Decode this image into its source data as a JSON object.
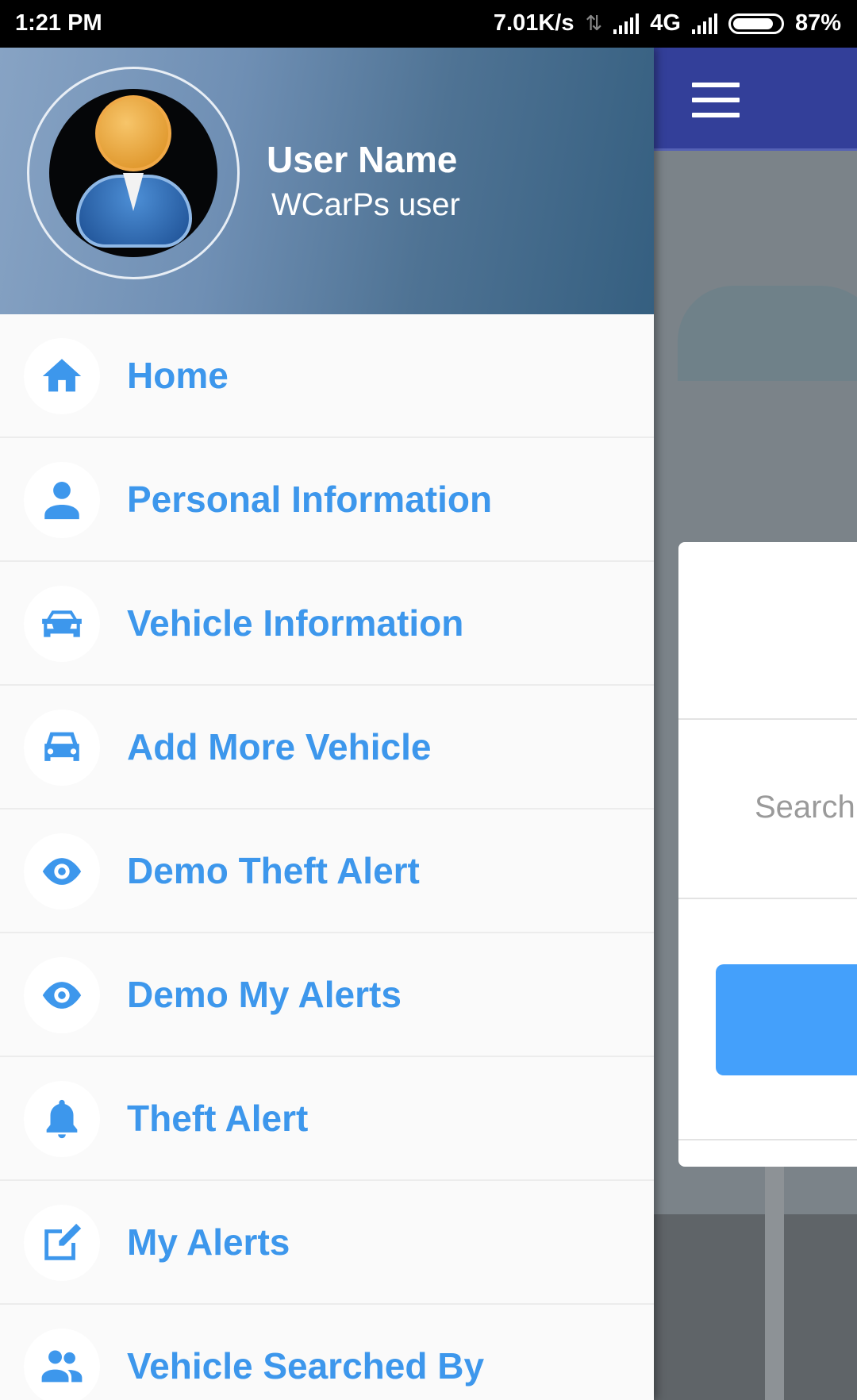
{
  "status_bar": {
    "time": "1:21 PM",
    "net_speed": "7.01K/s",
    "network_type": "4G",
    "battery": "87%"
  },
  "drawer": {
    "user_name": "User Name",
    "user_role": "WCarPs user",
    "menu": [
      {
        "label": "Home",
        "icon": "home-icon"
      },
      {
        "label": "Personal Information",
        "icon": "person-icon"
      },
      {
        "label": "Vehicle Information",
        "icon": "car-front-icon"
      },
      {
        "label": "Add More Vehicle",
        "icon": "car-icon"
      },
      {
        "label": "Demo Theft Alert",
        "icon": "eye-icon"
      },
      {
        "label": "Demo My Alerts",
        "icon": "eye-icon"
      },
      {
        "label": "Theft Alert",
        "icon": "bell-icon"
      },
      {
        "label": "My Alerts",
        "icon": "edit-icon"
      },
      {
        "label": "Vehicle Searched By",
        "icon": "group-icon"
      }
    ]
  },
  "background_app": {
    "search_placeholder": "Search"
  },
  "colors": {
    "accent": "#3d97ec",
    "toolbar": "#333f99",
    "button": "#44a0fb"
  }
}
